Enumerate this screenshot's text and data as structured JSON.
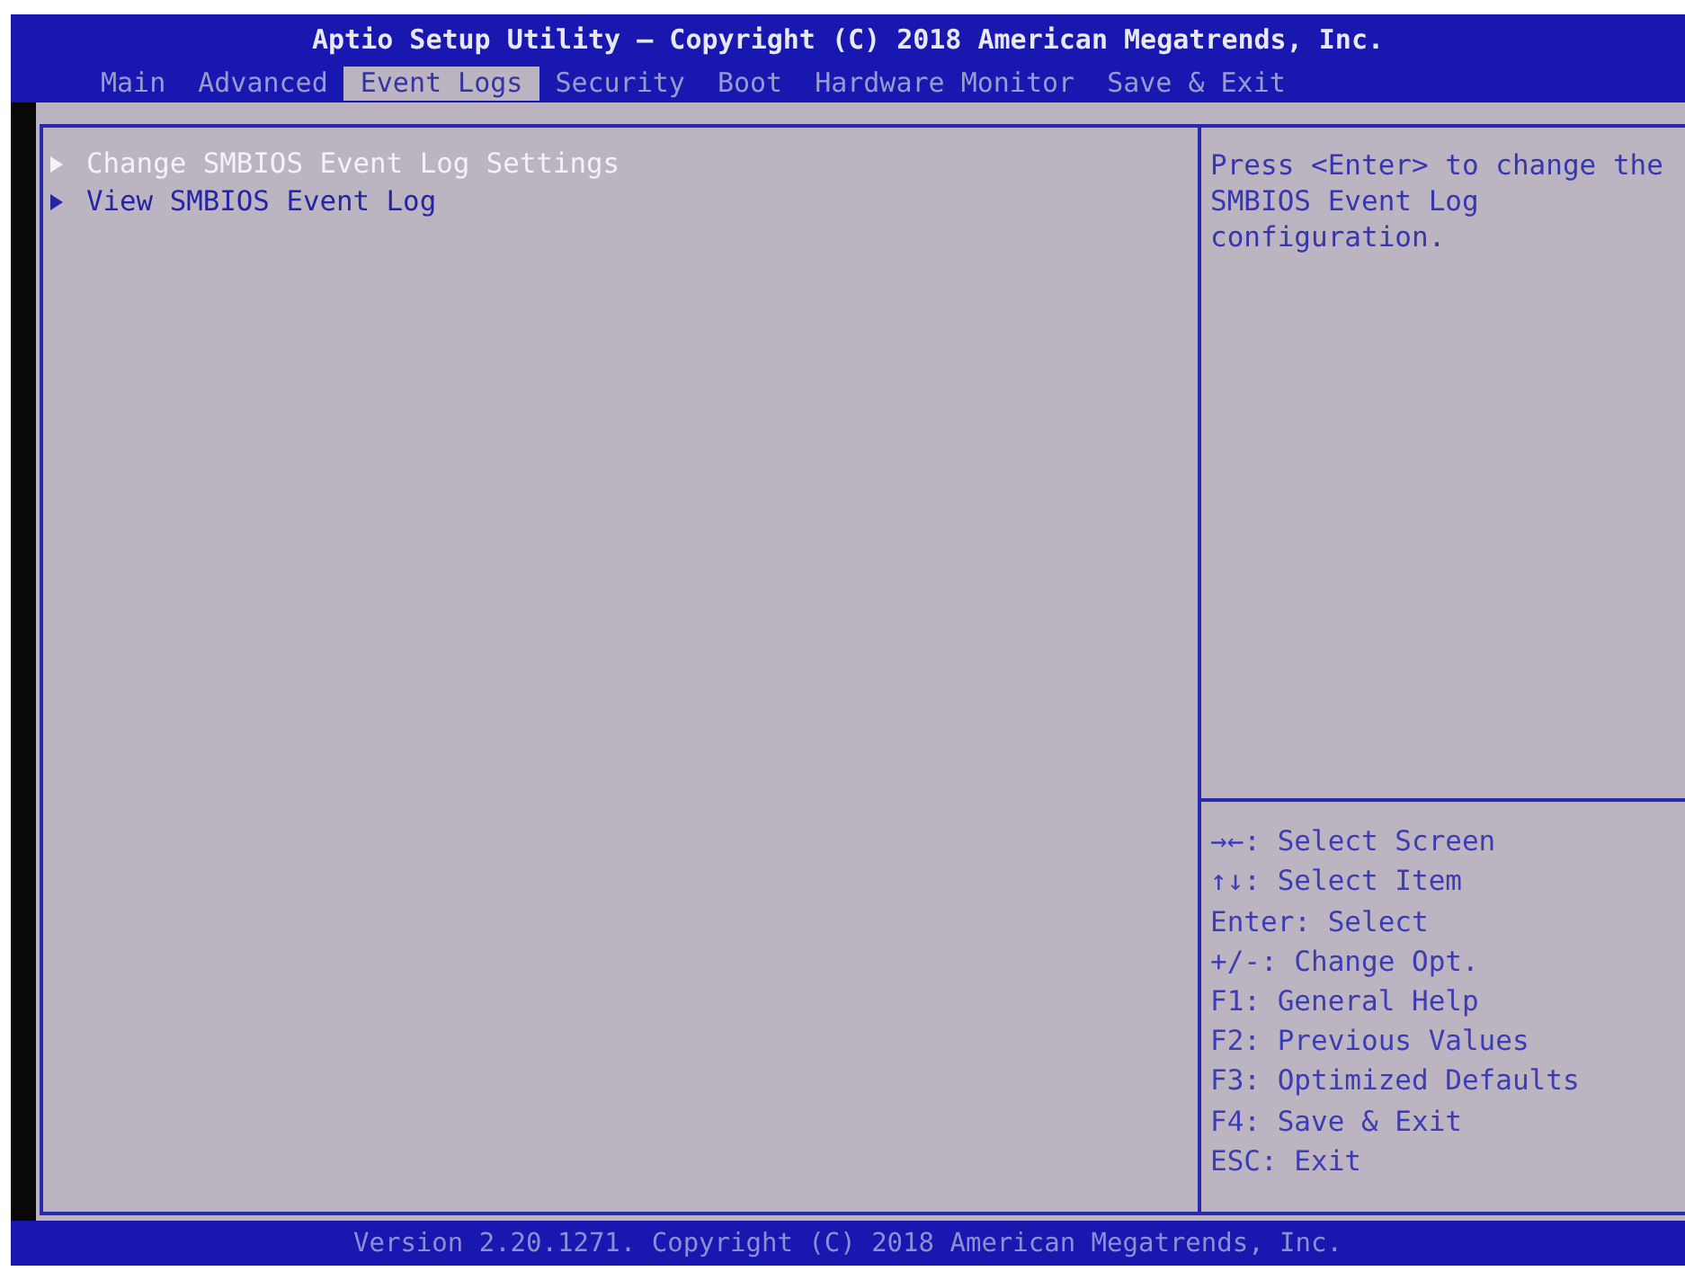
{
  "header": {
    "title": "Aptio Setup Utility – Copyright (C) 2018 American Megatrends, Inc."
  },
  "tabs": [
    {
      "label": "Main",
      "selected": false
    },
    {
      "label": "Advanced",
      "selected": false
    },
    {
      "label": "Event Logs",
      "selected": true
    },
    {
      "label": "Security",
      "selected": false
    },
    {
      "label": "Boot",
      "selected": false
    },
    {
      "label": "Hardware Monitor",
      "selected": false
    },
    {
      "label": "Save & Exit",
      "selected": false
    }
  ],
  "menu": {
    "items": [
      {
        "label": "Change SMBIOS Event Log Settings",
        "selected": true
      },
      {
        "label": "View SMBIOS Event Log",
        "selected": false
      }
    ]
  },
  "help": {
    "text": "Press <Enter> to change the SMBIOS Event Log configuration.",
    "keys": [
      "→←: Select Screen",
      "↑↓: Select Item",
      "Enter: Select",
      "+/-: Change Opt.",
      "F1: General Help",
      "F2: Previous Values",
      "F3: Optimized Defaults",
      "F4: Save & Exit",
      "ESC: Exit"
    ]
  },
  "footer": {
    "text": "Version 2.20.1271. Copyright (C) 2018 American Megatrends, Inc."
  }
}
